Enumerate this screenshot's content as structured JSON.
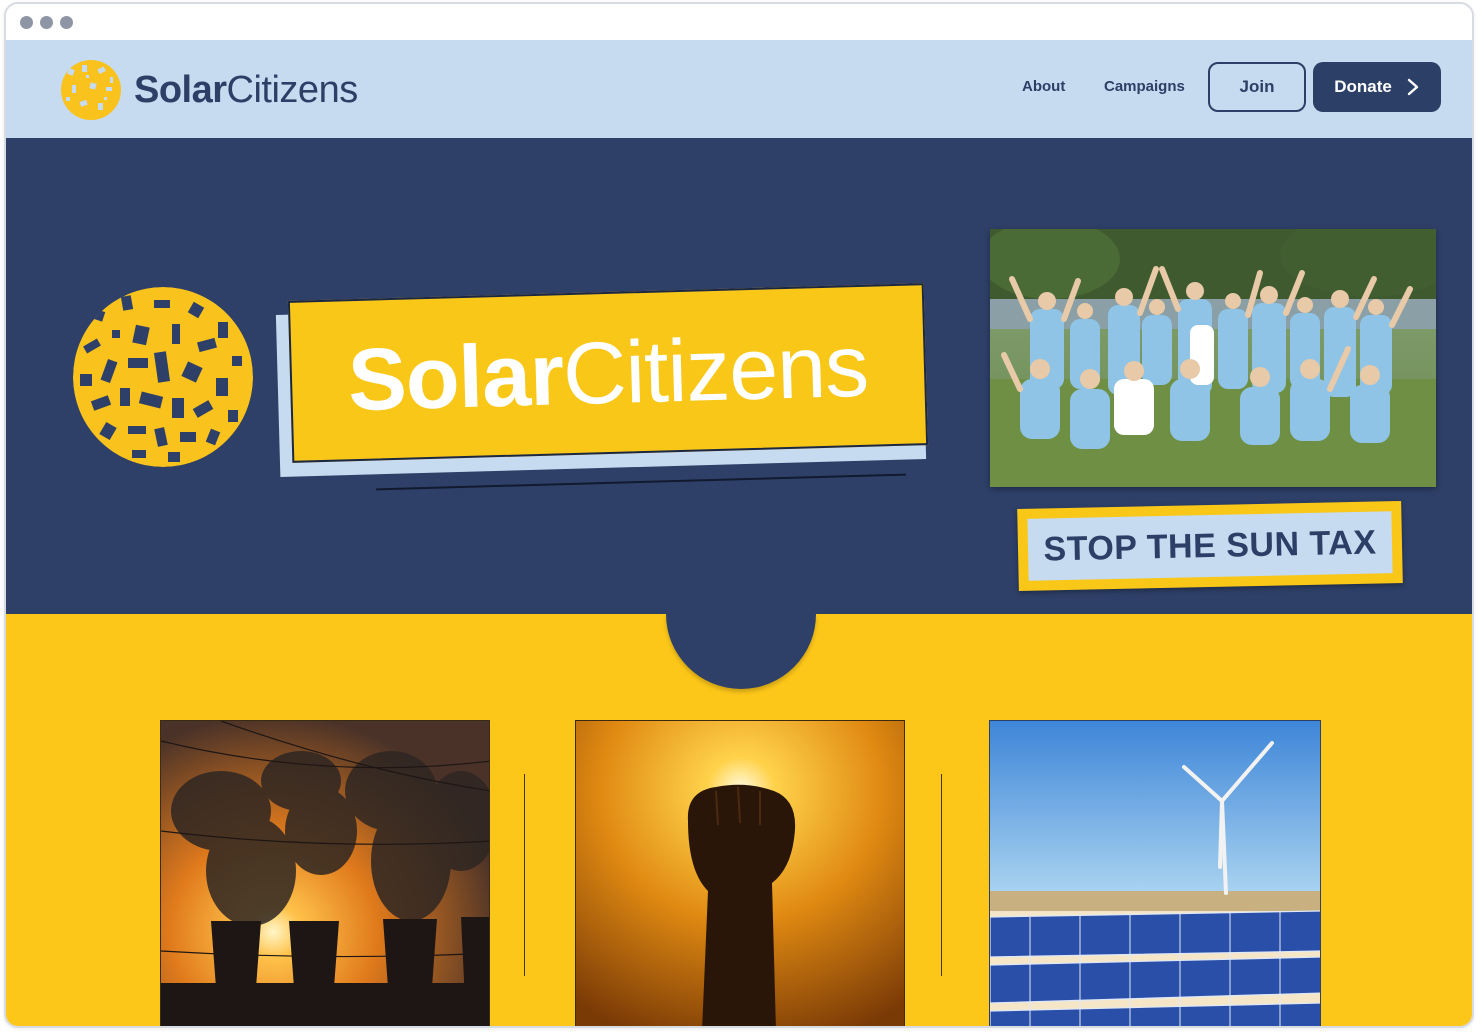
{
  "brand": {
    "name_bold": "Solar",
    "name_light": "Citizens"
  },
  "nav": {
    "about": "About",
    "campaigns": "Campaigns",
    "join": "Join",
    "donate": "Donate"
  },
  "hero": {
    "banner_bold": "Solar",
    "banner_light": "Citizens",
    "campaign_label": "STOP THE SUN TAX"
  },
  "colors": {
    "navy": "#2e4068",
    "yellow": "#fdc719",
    "light_blue": "#c6dbef",
    "banner_yellow": "#f9c718"
  },
  "icons": [
    "solar-globe-logo-icon",
    "chevron-right-icon"
  ],
  "cards": [
    {
      "name": "coal-power-station-photo"
    },
    {
      "name": "raised-fist-sunset-photo"
    },
    {
      "name": "wind-turbine-solar-panels-photo"
    }
  ]
}
